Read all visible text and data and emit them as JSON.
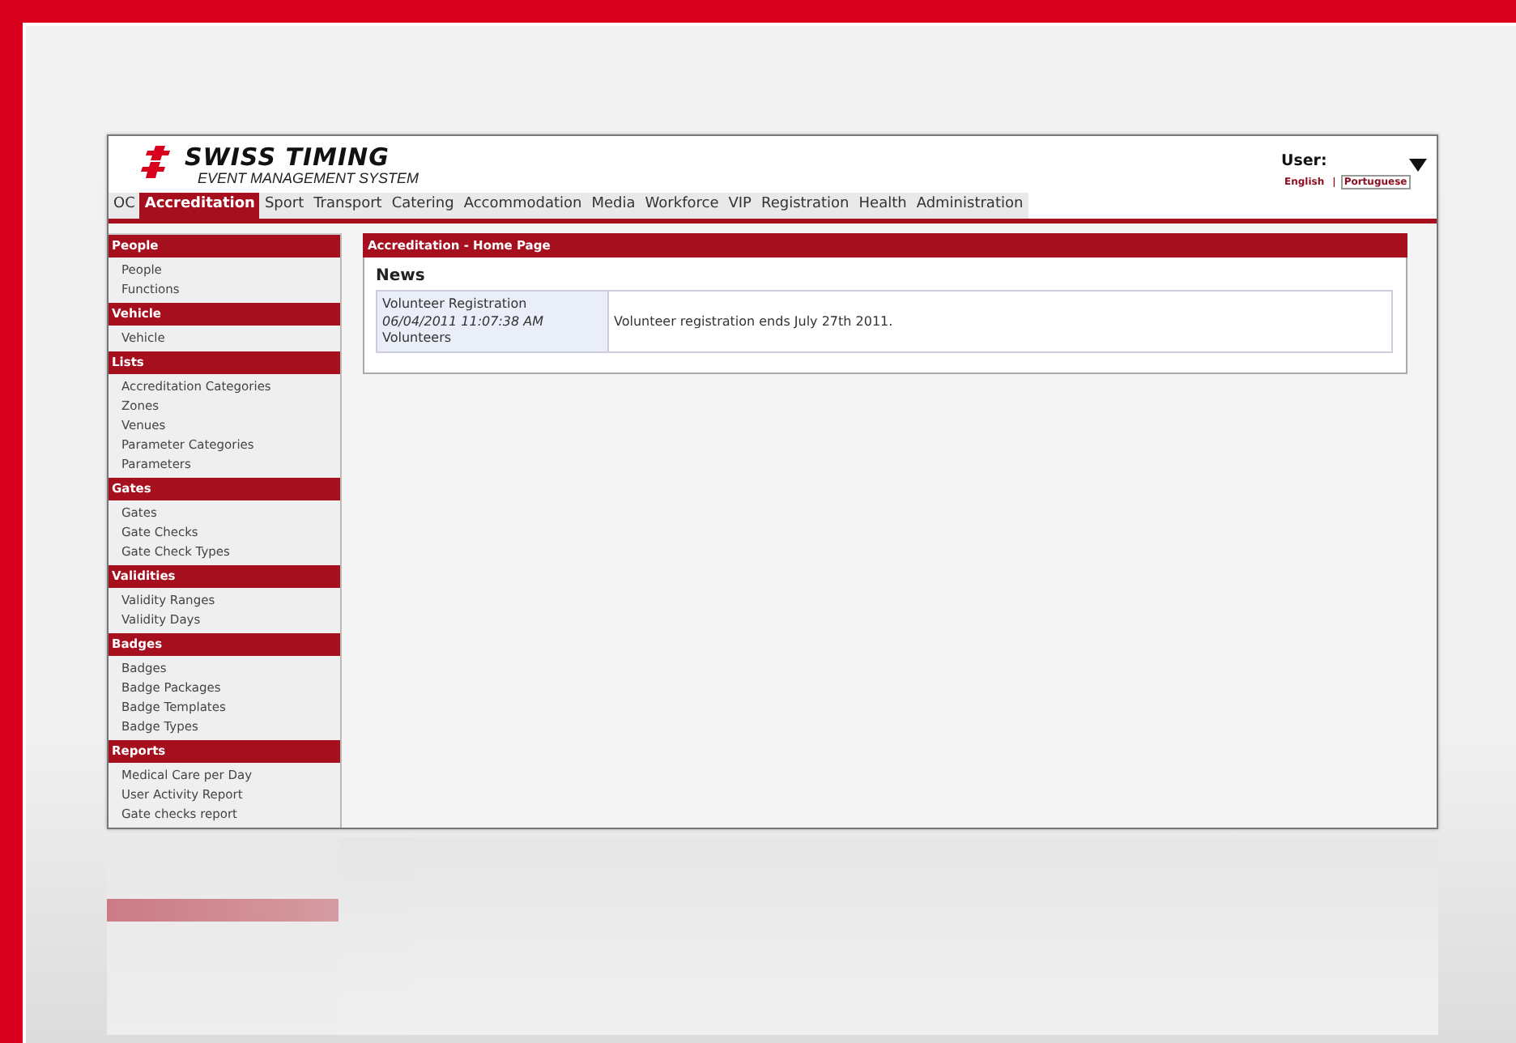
{
  "header": {
    "logo_title": "SWISS TIMING",
    "logo_subtitle": "EVENT MANAGEMENT SYSTEM",
    "user_label": "User:",
    "language_separator": "|",
    "languages": [
      {
        "label": "English",
        "selected": false
      },
      {
        "label": "Portuguese",
        "selected": true
      }
    ]
  },
  "tabs": [
    {
      "label": "OC",
      "selected": false
    },
    {
      "label": "Accreditation",
      "selected": true
    },
    {
      "label": "Sport",
      "selected": false
    },
    {
      "label": "Transport",
      "selected": false
    },
    {
      "label": "Catering",
      "selected": false
    },
    {
      "label": "Accommodation",
      "selected": false
    },
    {
      "label": "Media",
      "selected": false
    },
    {
      "label": "Workforce",
      "selected": false
    },
    {
      "label": "VIP",
      "selected": false
    },
    {
      "label": "Registration",
      "selected": false
    },
    {
      "label": "Health",
      "selected": false
    },
    {
      "label": "Administration",
      "selected": false
    }
  ],
  "sidebar": {
    "sections": [
      {
        "title": "People",
        "items": [
          "People",
          "Functions"
        ]
      },
      {
        "title": "Vehicle",
        "items": [
          "Vehicle"
        ]
      },
      {
        "title": "Lists",
        "items": [
          "Accreditation Categories",
          "Zones",
          "Venues",
          "Parameter Categories",
          "Parameters"
        ]
      },
      {
        "title": "Gates",
        "items": [
          "Gates",
          "Gate Checks",
          "Gate Check Types"
        ]
      },
      {
        "title": "Validities",
        "items": [
          "Validity Ranges",
          "Validity Days"
        ]
      },
      {
        "title": "Badges",
        "items": [
          "Badges",
          "Badge Packages",
          "Badge Templates",
          "Badge Types"
        ]
      },
      {
        "title": "Reports",
        "items": [
          "Medical Care per Day",
          "User Activity Report",
          "Gate checks report"
        ]
      }
    ]
  },
  "content": {
    "title": "Accreditation - Home Page",
    "news": {
      "heading": "News",
      "items": [
        {
          "title": "Volunteer Registration",
          "date": "06/04/2011 11:07:38 AM",
          "audience": "Volunteers",
          "message": "Volunteer registration ends July 27th 2011."
        }
      ]
    }
  }
}
